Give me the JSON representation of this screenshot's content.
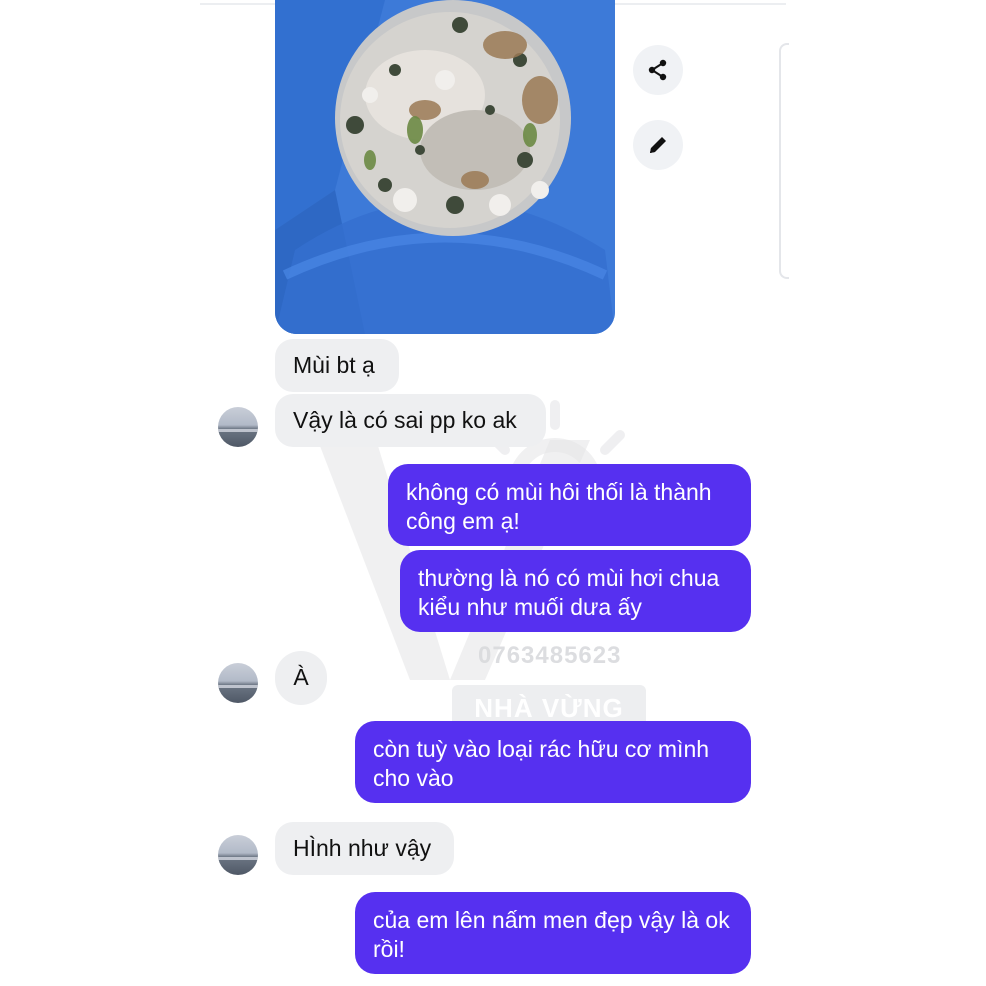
{
  "colors": {
    "sent_bubble": "#5630f0",
    "received_bubble": "#eeeff1",
    "action_button": "#f0f2f5"
  },
  "shared_image": {
    "icon_actions": [
      "share-icon",
      "edit-pencil-icon"
    ]
  },
  "messages": [
    {
      "side": "received",
      "text": "Mùi bt ạ",
      "avatar": false
    },
    {
      "side": "received",
      "text": "Vậy là có sai pp ko ak",
      "avatar": true
    },
    {
      "side": "sent",
      "text": "không có mùi hôi thối là thành công em ạ!"
    },
    {
      "side": "sent",
      "text": "thường là nó có mùi hơi chua kiểu như muối dưa ấy"
    },
    {
      "side": "received",
      "text": "À",
      "avatar": true
    },
    {
      "side": "sent",
      "text": "còn tuỳ vào loại rác hữu cơ mình cho vào"
    },
    {
      "side": "received",
      "text": "HÌnh như vậy",
      "avatar": true
    },
    {
      "side": "sent",
      "text": "của em lên nấm men đẹp vậy là ok rồi!"
    }
  ],
  "watermark": {
    "phone": "0763485623",
    "name": "NHÀ VỪNG"
  }
}
